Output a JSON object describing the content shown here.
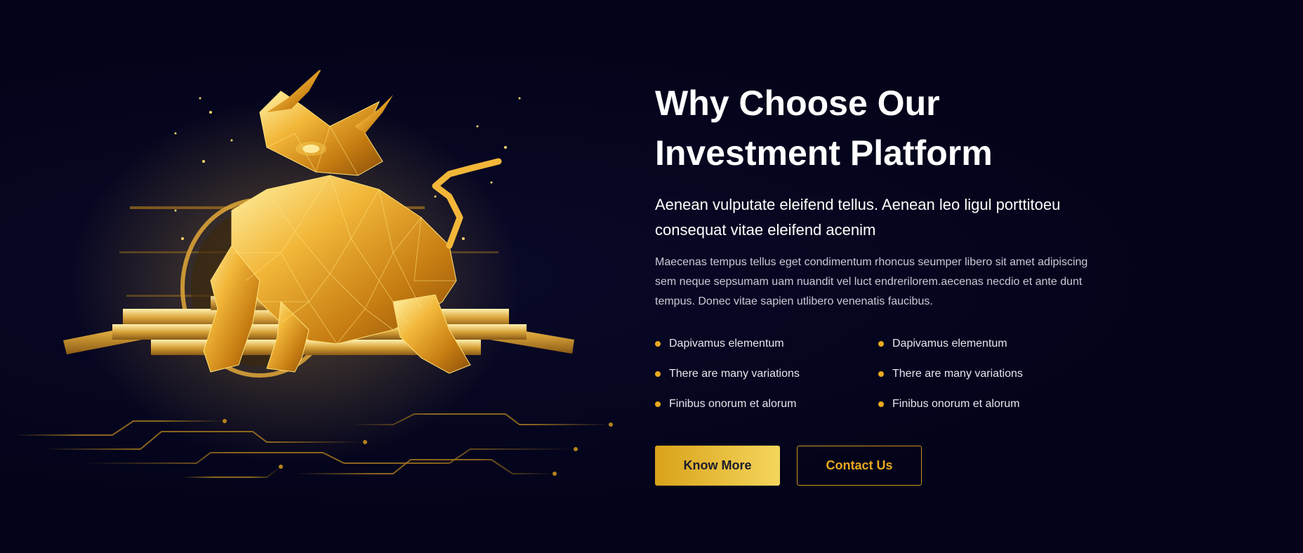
{
  "hero": {
    "illustration": "golden-polygon-bull-on-coins",
    "heading_line1": "Why Choose Our",
    "heading_line2": "Investment Platform",
    "subheading": "Aenean vulputate eleifend tellus. Aenean leo ligul porttitoeu consequat vitae eleifend acenim",
    "body": "Maecenas tempus tellus eget condimentum rhoncus seumper libero sit amet adipiscing sem neque sepsumam uam nuandit vel luct endrerilorem.aecenas necdio et ante dunt tempus. Donec vitae sapien utlibero venenatis faucibus."
  },
  "features": [
    {
      "label": "Dapivamus elementum"
    },
    {
      "label": "Dapivamus elementum"
    },
    {
      "label": "There are many variations"
    },
    {
      "label": "There are many variations"
    },
    {
      "label": "Finibus onorum et alorum"
    },
    {
      "label": "Finibus onorum et alorum"
    }
  ],
  "actions": {
    "know_more_label": "Know More",
    "contact_label": "Contact Us"
  },
  "colors": {
    "background": "#03031a",
    "accent_gold": "#e8a91c",
    "text_white": "#ffffff"
  }
}
